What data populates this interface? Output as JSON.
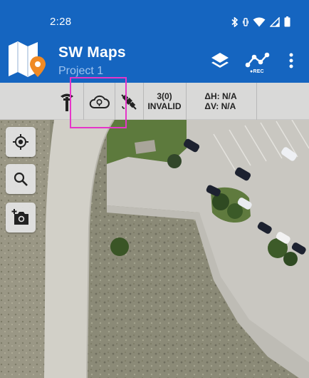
{
  "status_bar": {
    "time": "2:28",
    "icons": [
      "bluetooth-icon",
      "vibrate-icon",
      "wifi-icon",
      "signal-icon",
      "battery-icon"
    ]
  },
  "app_bar": {
    "title": "SW Maps",
    "subtitle": "Project 1",
    "actions": [
      "layers-icon",
      "record-track-icon",
      "more-options-icon"
    ],
    "record_label": "REC",
    "brand_color": "#1565c0"
  },
  "gnss_bar": {
    "items": [
      "gnss-receiver-icon",
      "ntrip-cloud-icon",
      "satellite-off-icon"
    ],
    "satellites": "3(0)",
    "fix_status": "INVALID",
    "h_accuracy": "ΔH: N/A",
    "v_accuracy": "ΔV: N/A",
    "highlight_color": "#e536c8"
  },
  "map_controls": [
    "my-location-icon",
    "search-icon",
    "add-photo-icon"
  ]
}
